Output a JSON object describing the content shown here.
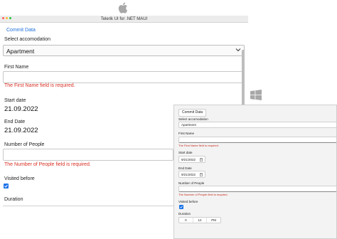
{
  "mac": {
    "window_title": "Telerik UI for .NET MAUI",
    "dot_colors": [
      "#ff5f57",
      "#febc2e",
      "#28c840"
    ],
    "commit_label": "Commit Data",
    "accommodation_label": "Select accomodation",
    "accommodation_value": "Apartment",
    "first_name_label": "First Name",
    "first_name_error": "The First Name field is required.",
    "start_date_label": "Start date",
    "start_date_value": "21.09.2022",
    "end_date_label": "End Date",
    "end_date_value": "21.09.2022",
    "people_label": "Number of People",
    "people_error": "The Number of People field is required.",
    "visited_label": "Visited before",
    "visited_checked": true,
    "duration_label": "Duration"
  },
  "win": {
    "commit_label": "Commit Data",
    "accommodation_label": "Select accomodation",
    "accommodation_value": "Apartment",
    "first_name_label": "First Name",
    "first_name_error": "The First Name field is required.",
    "start_date_label": "Start date",
    "start_date_value": "9/21/2022",
    "end_date_label": "End Date",
    "end_date_value": "9/21/2022",
    "people_label": "Number of People",
    "people_error": "The Number of People field is required.",
    "visited_label": "Visited before",
    "visited_checked": true,
    "duration_label": "Duration",
    "duration_hours": "0",
    "duration_minutes": "12",
    "duration_period": "PM"
  },
  "colors": {
    "accent": "#1c6fd9",
    "error": "#d93025",
    "checkbox": "#1a73e8"
  }
}
